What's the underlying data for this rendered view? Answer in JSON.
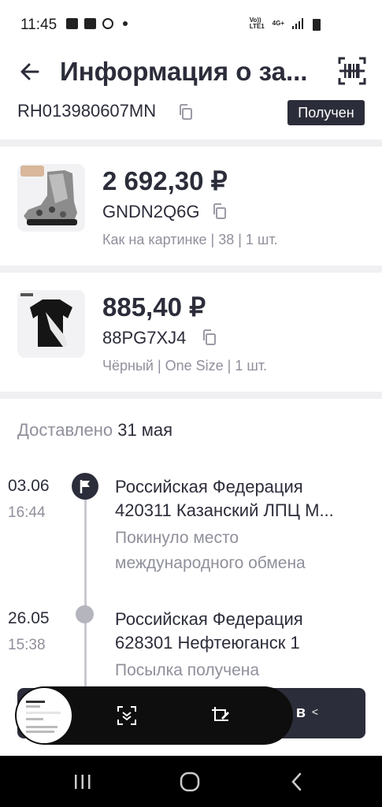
{
  "status_bar": {
    "time": "11:45",
    "net1": "Vo))",
    "net2": "LTE1",
    "net3": "4G+"
  },
  "header": {
    "title": "Информация о за...",
    "back_icon": "arrow-left-icon",
    "barcode_icon": "barcode-icon"
  },
  "tracking": {
    "number": "RH013980607MN",
    "status": "Получен"
  },
  "items": [
    {
      "price": "2 692,30 ₽",
      "sku": "GNDN2Q6G",
      "variant": "Как на картинке | 38 | 1 шт."
    },
    {
      "price": "885,40 ₽",
      "sku": "88PG7XJ4",
      "variant": "Чёрный | One Size | 1 шт."
    }
  ],
  "delivery": {
    "label": "Доставлено",
    "date": "31 мая"
  },
  "events": [
    {
      "date": "03.06",
      "time": "16:44",
      "location_line1": "Российская Федерация",
      "location_line2": "420311 Казанский ЛПЦ М...",
      "description": "Покинуло место международного обмена"
    },
    {
      "date": "26.05",
      "time": "15:38",
      "location_line1": "Российская Федерация",
      "location_line2": "628301 Нефтеюганск 1",
      "description": "Посылка получена"
    }
  ],
  "bottom_button": {
    "label_fragment": "в"
  },
  "colors": {
    "primary": "#2c2d3a",
    "muted": "#8f909b",
    "separator": "#f0f0f3"
  }
}
